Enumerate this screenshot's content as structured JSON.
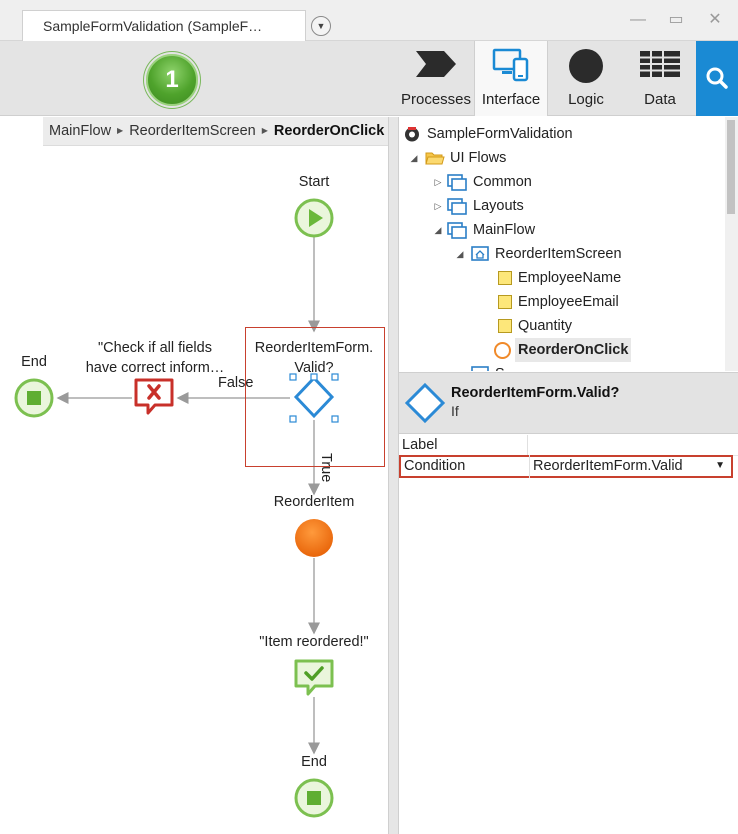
{
  "window": {
    "tab_title": "SampleFormValidation (SampleF…",
    "minimize_glyph": "—",
    "maximize_glyph": "▭",
    "close_glyph": "✕"
  },
  "toolbar": {
    "step_number": "1",
    "items": [
      {
        "label": "Processes",
        "icon": "processes-icon"
      },
      {
        "label": "Interface",
        "icon": "interface-icon"
      },
      {
        "label": "Logic",
        "icon": "logic-icon"
      },
      {
        "label": "Data",
        "icon": "data-icon"
      }
    ],
    "active_item": "Interface",
    "search_icon": "search-icon",
    "accent_color": "#1a8ad4"
  },
  "breadcrumb": {
    "items": [
      "MainFlow",
      "ReorderItemScreen"
    ],
    "current": "ReorderOnClick"
  },
  "flow": {
    "start_label": "Start",
    "if_label_line1": "ReorderItemForm.",
    "if_label_line2": "Valid?",
    "false_label": "False",
    "true_label": "True",
    "error_msg_line1": "\"Check if all fields",
    "error_msg_line2": "have correct inform…",
    "end_left_label": "End",
    "assign_label": "ReorderItem",
    "success_msg_label": "\"Item reordered!\"",
    "end_bottom_label": "End"
  },
  "tree": {
    "root": "SampleFormValidation",
    "ui_flows": "UI Flows",
    "common": "Common",
    "layouts": "Layouts",
    "mainflow": "MainFlow",
    "screen": "ReorderItemScreen",
    "vars": [
      "EmployeeName",
      "EmployeeEmail",
      "Quantity"
    ],
    "action": "ReorderOnClick",
    "partial": "S…"
  },
  "properties": {
    "title": "ReorderItemForm.Valid?",
    "subtitle": "If",
    "rows": [
      {
        "key": "Label",
        "value": ""
      },
      {
        "key": "Condition",
        "value": "ReorderItemForm.Valid"
      }
    ],
    "dropdown_glyph": "▼"
  }
}
